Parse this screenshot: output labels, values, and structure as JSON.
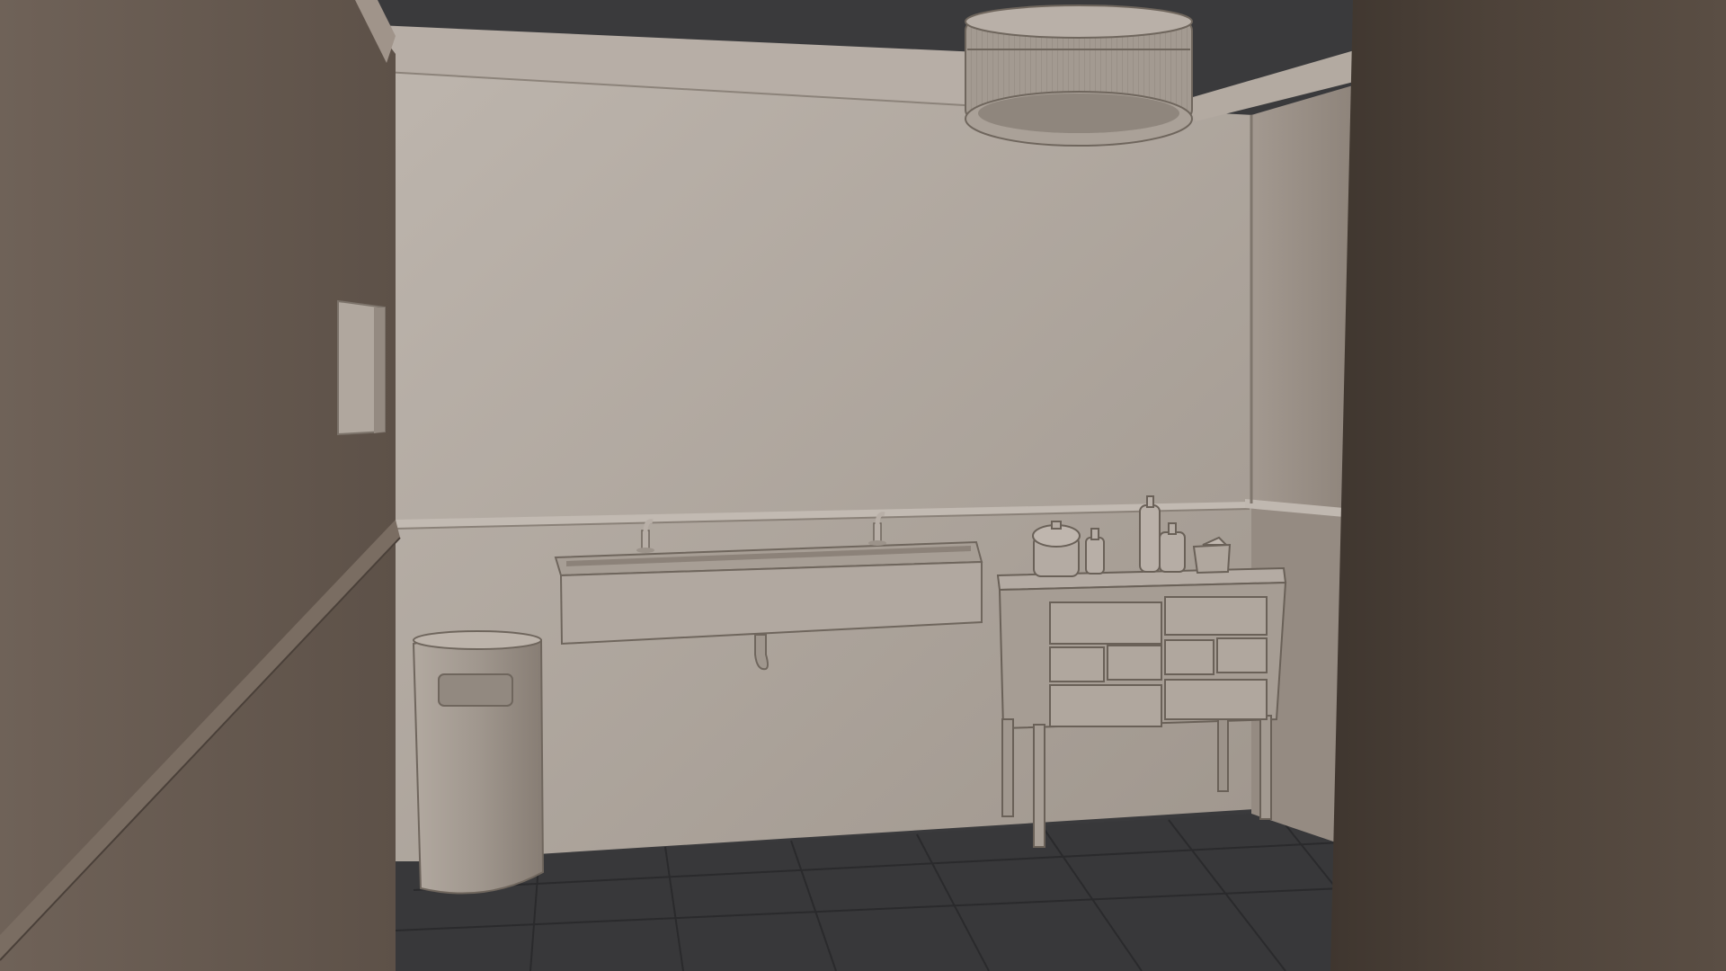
{
  "scene": {
    "description_visible_text": "",
    "colors": {
      "ceiling": "#3a3a3c",
      "floor": "#38383a",
      "floor_grid": "#2b2b2d",
      "back_wall_light": "#b9b0a8",
      "back_wall_dark": "#a39a91",
      "right_wall": "#9b9188",
      "left_wall": "#6c6056",
      "left_wall_dark": "#5a4f46",
      "near_right_wall": "#4e443c",
      "fixture": "#a79d94",
      "fixture_shadow": "#857b72",
      "molding": "#b3aaa1",
      "outline": "#6b625a"
    },
    "objects": {
      "ceiling_lamp": "drum-pendant-light",
      "sink": "trough-sink-with-two-faucets",
      "trash_bin": "half-round-waste-bin",
      "towel_dispenser": "paper-towel-dispenser",
      "cabinet": "apothecary-drawer-cabinet",
      "cabinet_items": [
        "lidded-jar",
        "small-bottle",
        "tall-bottle",
        "pump-bottle",
        "tissue-box"
      ]
    }
  }
}
